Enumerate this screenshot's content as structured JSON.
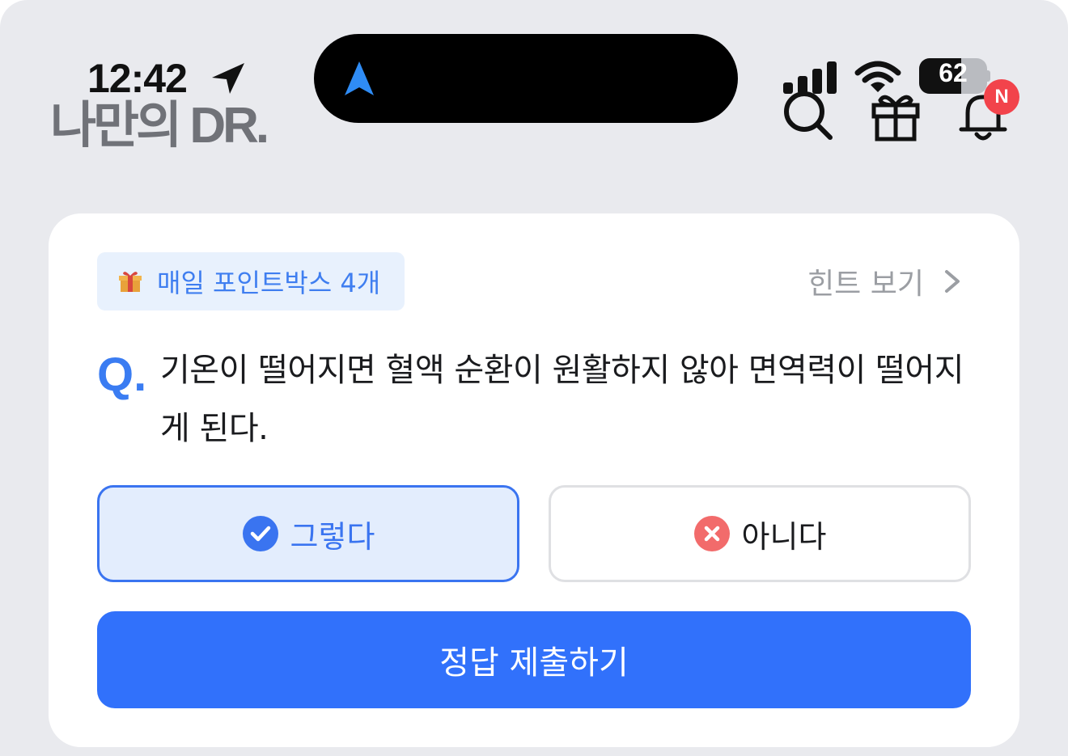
{
  "status_bar": {
    "time": "12:42",
    "battery_percent": "62",
    "battery_level": 0.62,
    "icons": [
      "location-arrow-icon",
      "signal-icon",
      "wifi-icon",
      "battery-icon"
    ]
  },
  "dynamic_island": {
    "icon": "navigation-arrow-icon"
  },
  "header": {
    "logo_text": "나만의 DR.",
    "icons": [
      "search-icon",
      "gift-icon",
      "bell-icon"
    ],
    "notification_badge": "N"
  },
  "quiz": {
    "point_box_label": "매일 포인트박스 4개",
    "point_box_icon": "gift-emoji-icon",
    "hint_label": "힌트 보기",
    "question_mark": "Q.",
    "question_text": "기온이 떨어지면 혈액 순환이 원활하지 않아 면역력이 떨어지게 된다.",
    "answer_yes": "그렇다",
    "answer_no": "아니다",
    "selected": "yes",
    "submit_label": "정답 제출하기"
  },
  "colors": {
    "accent": "#3171fb",
    "selected_fill": "#e3edfd",
    "badge_red": "#f2434b",
    "no_icon": "#f26b6b",
    "background": "#e9eaee"
  }
}
